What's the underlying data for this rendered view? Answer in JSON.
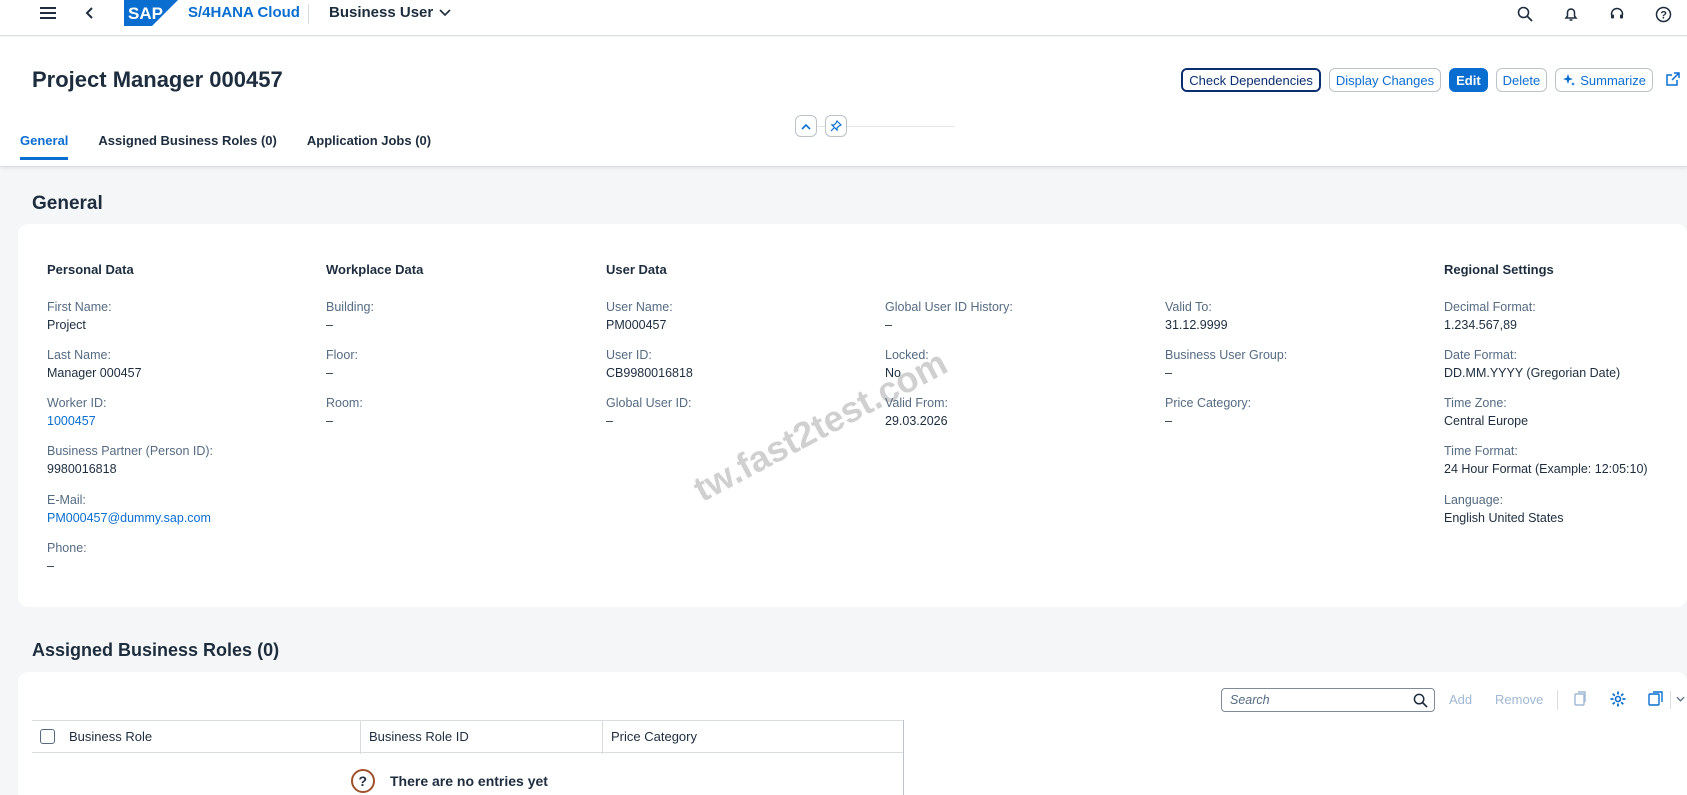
{
  "shell": {
    "logo_text": "SAP",
    "product": "S/4HANA Cloud",
    "app_name": "Business User",
    "icons": [
      "menu-icon",
      "back-icon",
      "search-icon",
      "notifications-icon",
      "support-icon",
      "help-icon"
    ]
  },
  "header": {
    "title": "Project Manager 000457",
    "actions": {
      "check_dependencies": "Check Dependencies",
      "display_changes": "Display Changes",
      "edit": "Edit",
      "delete": "Delete",
      "summarize": "Summarize"
    },
    "tabs": [
      {
        "label": "General",
        "active": true
      },
      {
        "label": "Assigned Business Roles (0)",
        "active": false
      },
      {
        "label": "Application Jobs (0)",
        "active": false
      }
    ]
  },
  "general": {
    "section_title": "General",
    "personal": {
      "title": "Personal Data",
      "first_name_label": "First Name:",
      "first_name": "Project",
      "last_name_label": "Last Name:",
      "last_name": "Manager 000457",
      "worker_id_label": "Worker ID:",
      "worker_id": "1000457",
      "bp_label": "Business Partner (Person ID):",
      "bp": "9980016818",
      "email_label": "E-Mail:",
      "email": "PM000457@dummy.sap.com",
      "phone_label": "Phone:",
      "phone": "–"
    },
    "workplace": {
      "title": "Workplace Data",
      "building_label": "Building:",
      "building": "–",
      "floor_label": "Floor:",
      "floor": "–",
      "room_label": "Room:",
      "room": "–"
    },
    "user": {
      "title": "User Data",
      "user_name_label": "User Name:",
      "user_name": "PM000457",
      "user_id_label": "User ID:",
      "user_id": "CB9980016818",
      "global_user_id_label": "Global User ID:",
      "global_user_id": "–",
      "global_history_label": "Global User ID History:",
      "global_history": "–",
      "locked_label": "Locked:",
      "locked": "No",
      "valid_from_label": "Valid From:",
      "valid_from": "29.03.2026",
      "valid_to_label": "Valid To:",
      "valid_to": "31.12.9999",
      "bu_group_label": "Business User Group:",
      "bu_group": "–",
      "price_cat_label": "Price Category:",
      "price_cat": "–"
    },
    "regional": {
      "title": "Regional Settings",
      "decimal_label": "Decimal Format:",
      "decimal": "1.234.567,89",
      "date_label": "Date Format:",
      "date": "DD.MM.YYYY (Gregorian Date)",
      "tz_label": "Time Zone:",
      "tz": "Central Europe",
      "time_label": "Time Format:",
      "time": "24 Hour Format (Example: 12:05:10)",
      "lang_label": "Language:",
      "lang": "English United States"
    }
  },
  "roles": {
    "section_title": "Assigned Business Roles (0)",
    "search_placeholder": "Search",
    "add": "Add",
    "remove": "Remove",
    "columns": [
      "Business Role",
      "Business Role ID",
      "Price Category"
    ],
    "empty_text": "There are no entries yet"
  },
  "watermark": "tw.fast2test.com",
  "colors": {
    "accent": "#0a6ed1",
    "text": "#1d2d3e",
    "label": "#556b82",
    "background": "#f5f6f7"
  }
}
